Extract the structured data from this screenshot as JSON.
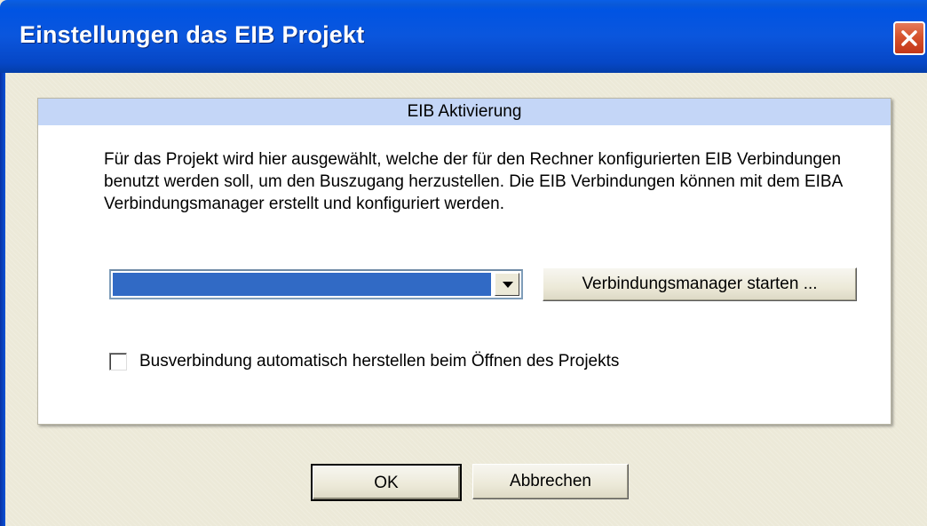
{
  "window": {
    "title": "Einstellungen das EIB Projekt",
    "close_icon": "close-x-icon"
  },
  "panel": {
    "header": "EIB Aktivierung",
    "description": "Für das Projekt wird hier ausgewählt, welche der für den Rechner konfigurierten EIB Verbindungen benutzt werden soll, um den Buszugang herzustellen. Die EIB Verbindungen können mit dem EIBA Verbindungsmanager erstellt und konfiguriert werden.",
    "connection_select": {
      "selected_value": "",
      "arrow_icon": "chevron-down-icon"
    },
    "manager_button": "Verbindungsmanager starten ...",
    "auto_connect": {
      "label": "Busverbindung automatisch herstellen beim Öffnen des Projekts",
      "checked": false
    }
  },
  "buttons": {
    "ok": "OK",
    "cancel": "Abbrechen"
  },
  "colors": {
    "titlebar": "#0054e3",
    "panel_header": "#c4d6f7",
    "selection": "#316ac5",
    "face": "#ece9d8"
  }
}
